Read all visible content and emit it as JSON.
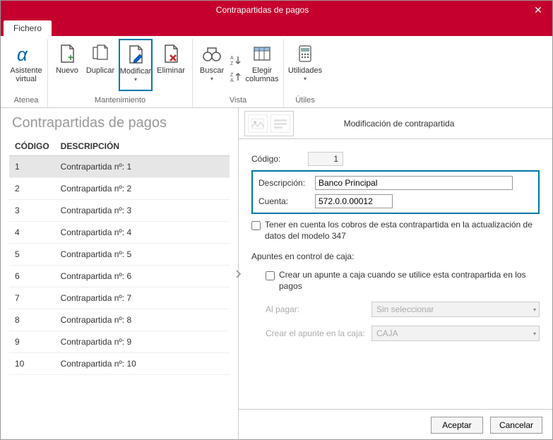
{
  "titlebar": {
    "title": "Contrapartidas de pagos",
    "close": "✕"
  },
  "tabs": {
    "fichero": "Fichero"
  },
  "ribbon": {
    "atenea_group": "Atenea",
    "mant_group": "Mantenimiento",
    "vista_group": "Vista",
    "utiles_group": "Útiles",
    "asistente": "Asistente\nvirtual",
    "nuevo": "Nuevo",
    "duplicar": "Duplicar",
    "modificar": "Modificar",
    "eliminar": "Eliminar",
    "buscar": "Buscar",
    "elegir_col": "Elegir\ncolumnas",
    "utilidades": "Utilidades"
  },
  "left": {
    "title": "Contrapartidas de pagos",
    "columns": {
      "codigo": "CÓDIGO",
      "descripcion": "DESCRIPCIÓN"
    },
    "rows": [
      {
        "code": "1",
        "desc": "Contrapartida nº: 1"
      },
      {
        "code": "2",
        "desc": "Contrapartida nº: 2"
      },
      {
        "code": "3",
        "desc": "Contrapartida nº: 3"
      },
      {
        "code": "4",
        "desc": "Contrapartida nº: 4"
      },
      {
        "code": "5",
        "desc": "Contrapartida nº: 5"
      },
      {
        "code": "6",
        "desc": "Contrapartida nº: 6"
      },
      {
        "code": "7",
        "desc": "Contrapartida nº: 7"
      },
      {
        "code": "8",
        "desc": "Contrapartida nº: 8"
      },
      {
        "code": "9",
        "desc": "Contrapartida nº: 9"
      },
      {
        "code": "10",
        "desc": "Contrapartida nº: 10"
      }
    ]
  },
  "right": {
    "header_title": "Modificación de contrapartida",
    "codigo_label": "Código:",
    "codigo_value": "1",
    "descripcion_label": "Descripción:",
    "descripcion_value": "Banco Principal",
    "cuenta_label": "Cuenta:",
    "cuenta_value": "572.0.0.00012",
    "check347": "Tener en cuenta los cobros de esta contrapartida en la actualización de datos del modelo 347",
    "apuntes_section": "Apuntes en control de caja:",
    "check_crear_apunte": "Crear un apunte a caja cuando se utilice esta contrapartida en los pagos",
    "al_pagar_label": "Al pagar:",
    "al_pagar_value": "Sin seleccionar",
    "crear_caja_label": "Crear el apunte en la caja:",
    "crear_caja_value": "CAJA"
  },
  "footer": {
    "aceptar": "Aceptar",
    "cancelar": "Cancelar"
  }
}
